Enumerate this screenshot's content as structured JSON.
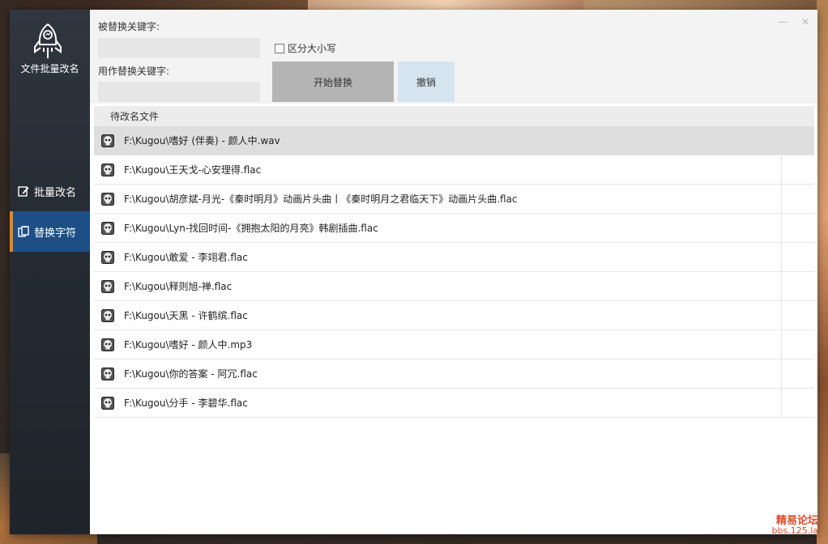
{
  "app": {
    "name": "文件批量改名"
  },
  "nav": {
    "items": [
      {
        "label": "批量改名",
        "icon": "edit-icon",
        "active": false
      },
      {
        "label": "替换字符",
        "icon": "clipboard-icon",
        "active": true
      }
    ],
    "active_color": "#1d4f86",
    "accent_color": "#e8861e"
  },
  "form": {
    "find_label": "被替换关键字:",
    "find_value": "",
    "replace_label": "用作替换关键字:",
    "replace_value": "",
    "case_label": "区分大小写",
    "case_checked": false,
    "start_label": "开始替换",
    "undo_label": "撤销"
  },
  "list": {
    "header": "待改名文件",
    "selected_index": 0,
    "rows": [
      "F:\\Kugou\\嗜好 (伴奏) - 颜人中.wav",
      "F:\\Kugou\\王天戈-心安理得.flac",
      "F:\\Kugou\\胡彦斌-月光-《秦时明月》动画片头曲丨《秦时明月之君临天下》动画片头曲.flac",
      "F:\\Kugou\\Lyn-找回时间-《拥抱太阳的月亮》韩剧插曲.flac",
      "F:\\Kugou\\敢爱 - 李翊君.flac",
      "F:\\Kugou\\释则旭-禅.flac",
      "F:\\Kugou\\天黑 - 许鹤缤.flac",
      "F:\\Kugou\\嗜好 - 颜人中.mp3",
      "F:\\Kugou\\你的答案 - 阿冗.flac",
      "F:\\Kugou\\分手 - 李碧华.flac"
    ]
  },
  "watermark": {
    "line1": "精易论坛",
    "line2": "bbs.125.la"
  }
}
